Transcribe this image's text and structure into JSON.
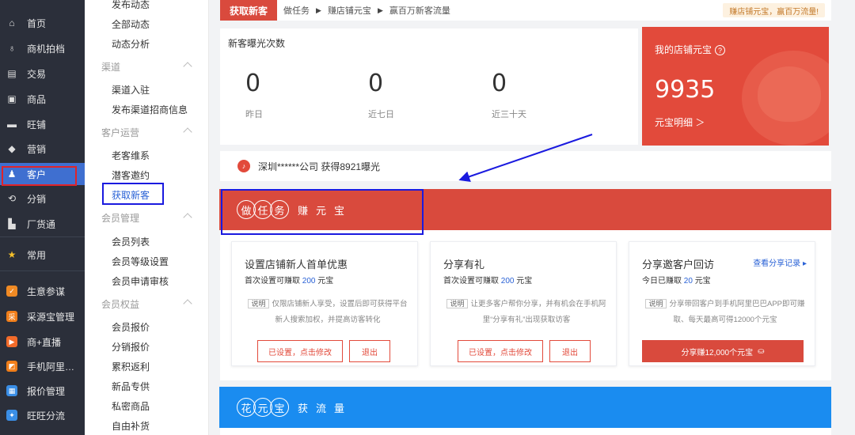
{
  "left_nav": {
    "items": [
      {
        "label": "首页",
        "icon": "home-icon",
        "glyph": "⌂"
      },
      {
        "label": "商机拍档",
        "icon": "handshake-icon",
        "glyph": "♁"
      },
      {
        "label": "交易",
        "icon": "trade-icon",
        "glyph": "▤"
      },
      {
        "label": "商品",
        "icon": "product-icon",
        "glyph": "▣"
      },
      {
        "label": "旺铺",
        "icon": "shop-icon",
        "glyph": "▬"
      },
      {
        "label": "营销",
        "icon": "tag-icon",
        "glyph": "◆"
      },
      {
        "label": "客户",
        "icon": "user-icon",
        "glyph": "♟"
      },
      {
        "label": "分销",
        "icon": "distribution-icon",
        "glyph": "⟲"
      },
      {
        "label": "厂货通",
        "icon": "factory-icon",
        "glyph": "▙"
      }
    ],
    "common": {
      "label": "常用",
      "icon": "star-icon",
      "glyph": "★"
    },
    "apps": [
      {
        "label": "生意参谋",
        "color": "#f08a24",
        "glyph": "✓"
      },
      {
        "label": "采源宝管理",
        "color": "#f07e1a",
        "glyph": "采"
      },
      {
        "label": "商+直播",
        "color": "#f26b2a",
        "glyph": "▶"
      },
      {
        "label": "手机阿里…",
        "color": "#f07e1a",
        "glyph": "◩"
      },
      {
        "label": "报价管理",
        "color": "#3a8ee6",
        "glyph": "▦"
      },
      {
        "label": "旺旺分流",
        "color": "#3a8ee6",
        "glyph": "✦"
      }
    ]
  },
  "sub_menu": {
    "items": [
      {
        "label": "发布动态",
        "type": "item"
      },
      {
        "label": "全部动态",
        "type": "item"
      },
      {
        "label": "动态分析",
        "type": "item"
      },
      {
        "label": "渠道",
        "type": "cat"
      },
      {
        "label": "渠道入驻",
        "type": "item"
      },
      {
        "label": "发布渠道招商信息",
        "type": "item"
      },
      {
        "label": "客户运营",
        "type": "cat"
      },
      {
        "label": "老客维系",
        "type": "item"
      },
      {
        "label": "潜客邀约",
        "type": "item"
      },
      {
        "label": "获取新客",
        "type": "active"
      },
      {
        "label": "会员管理",
        "type": "cat"
      },
      {
        "label": "会员列表",
        "type": "item"
      },
      {
        "label": "会员等级设置",
        "type": "item"
      },
      {
        "label": "会员申请审核",
        "type": "item"
      },
      {
        "label": "会员权益",
        "type": "cat"
      },
      {
        "label": "会员报价",
        "type": "item"
      },
      {
        "label": "分销报价",
        "type": "item"
      },
      {
        "label": "累积返利",
        "type": "item"
      },
      {
        "label": "新品专供",
        "type": "item"
      },
      {
        "label": "私密商品",
        "type": "item"
      },
      {
        "label": "自由补货",
        "type": "item"
      }
    ]
  },
  "breadcrumb": {
    "active": "获取新客",
    "step1": "做任务",
    "step2": "赚店铺元宝",
    "step3": "赢百万新客流量",
    "promo": "赚店铺元宝，赢百万流量!"
  },
  "stats": {
    "title": "新客曝光次数",
    "items": [
      {
        "value": "0",
        "label": "昨日"
      },
      {
        "value": "0",
        "label": "近七日"
      },
      {
        "value": "0",
        "label": "近三十天"
      }
    ]
  },
  "yuanbao": {
    "title": "我的店铺元宝",
    "help": "?",
    "value": "9935",
    "link": "元宝明细 ＞"
  },
  "notice": {
    "text": "深圳******公司 获得8921曝光",
    "icon": "bell-icon"
  },
  "task_banner": {
    "seals": [
      "做",
      "任",
      "务"
    ],
    "rest": "赚元宝"
  },
  "tasks": [
    {
      "title": "设置店铺新人首单优惠",
      "sub_prefix": "首次设置可赚取",
      "sub_num": "200",
      "sub_suffix": "元宝",
      "tag": "说明",
      "desc": "仅限店铺新人享受，设置后即可获得平台新人搜索加权，并提高访客转化",
      "btn1": "已设置，点击修改",
      "btn2": "退出"
    },
    {
      "title": "分享有礼",
      "sub_prefix": "首次设置可赚取",
      "sub_num": "200",
      "sub_suffix": "元宝",
      "tag": "说明",
      "desc": "让更多客户帮你分享，并有机会在手机阿里“分享有礼”出现获取访客",
      "btn1": "已设置，点击修改",
      "btn2": "退出"
    },
    {
      "title": "分享邀客户回访",
      "link": "查看分享记录 ▸",
      "sub_prefix": "今日已赚取",
      "sub_num": "20",
      "sub_suffix": "元宝",
      "tag": "说明",
      "desc": "分享带回客户到手机阿里巴巴APP即可赚取、每天最高可得12000个元宝",
      "btn": "分享赚12,000个元宝"
    }
  ],
  "flow_banner": {
    "seals": [
      "花",
      "元",
      "宝"
    ],
    "rest": "获流量"
  },
  "colors": {
    "nav_bg": "#2b2f3a",
    "accent_red": "#d94a3d",
    "accent_blue": "#1a8cf0",
    "annotation_red": "#e0242a",
    "annotation_blue": "#1a1adf"
  }
}
